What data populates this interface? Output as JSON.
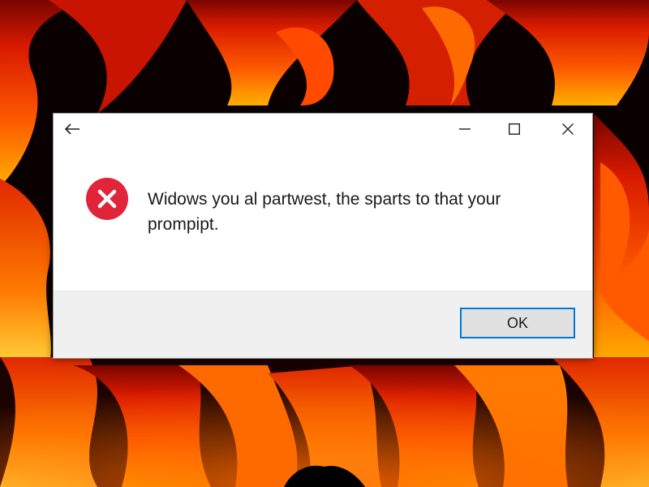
{
  "desktop": {
    "background": "flames"
  },
  "dialog": {
    "titlebar": {
      "back_icon": "back-arrow-icon",
      "minimize_icon": "minimize-icon",
      "maximize_icon": "maximize-icon",
      "close_icon": "close-icon"
    },
    "icon": "error-icon",
    "message": "Widows you al partwest, the sparts to that your prompipt.",
    "ok_label": "OK",
    "colors": {
      "error_red": "#e0243a",
      "button_focus_border": "#0078d7",
      "footer_background": "#f0f0f0"
    }
  }
}
